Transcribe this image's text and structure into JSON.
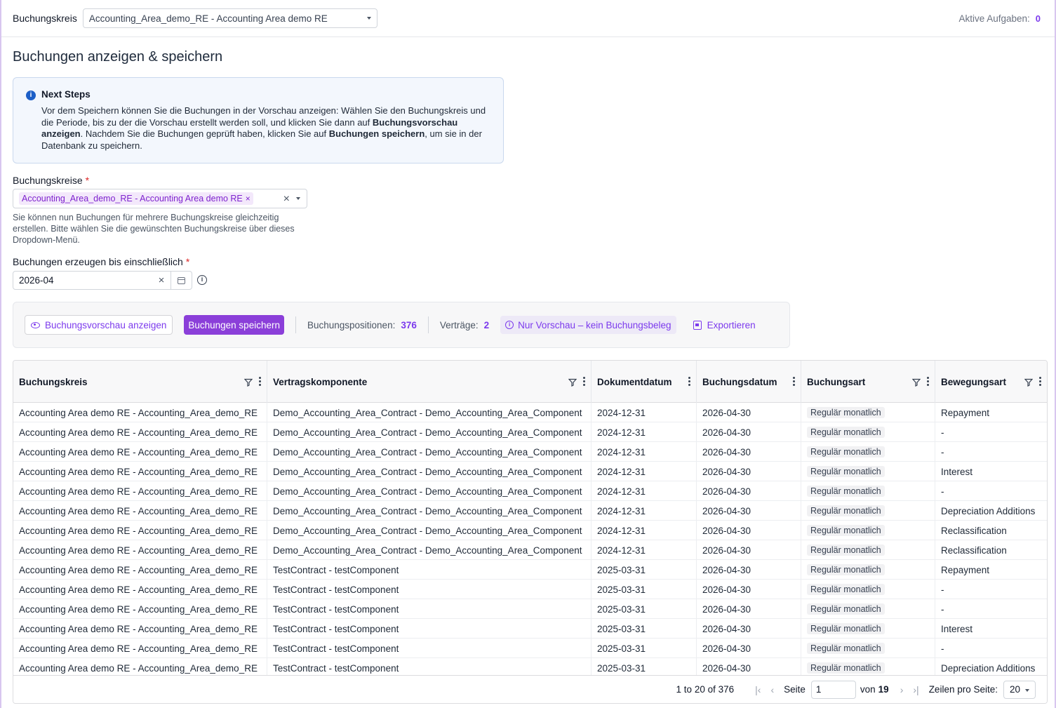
{
  "topbar": {
    "label": "Buchungskreis",
    "selected": "Accounting_Area_demo_RE - Accounting Area demo RE",
    "tasks_label": "Aktive Aufgaben:",
    "tasks_count": "0"
  },
  "page_title": "Buchungen anzeigen & speichern",
  "info": {
    "title": "Next Steps",
    "text_1": "Vor dem Speichern können Sie die Buchungen in der Vorschau anzeigen: Wählen Sie den Buchungskreis und die Periode, bis zu der die Vorschau erstellt werden soll, und klicken Sie dann auf ",
    "bold_1": "Buchungsvorschau anzeigen",
    "text_2": ". Nachdem Sie die Buchungen geprüft haben, klicken Sie auf ",
    "bold_2": "Buchungen speichern",
    "text_3": ", um sie in der Datenbank zu speichern."
  },
  "form": {
    "areas_label": "Buchungskreise",
    "required": "*",
    "area_chip": "Accounting_Area_demo_RE - Accounting Area demo RE",
    "helper": "Sie können nun Buchungen für mehrere Buchungskreise gleichzeitig erstellen. Bitte wählen Sie die gewünschten Buchungskreise über dieses Dropdown-Menü.",
    "until_label": "Buchungen erzeugen bis einschließlich",
    "until_value": "2026-04"
  },
  "toolbar": {
    "preview_label": "Buchungsvorschau anzeigen",
    "save_label": "Buchungen speichern",
    "positions_label": "Buchungspositionen:",
    "positions_count": "376",
    "contracts_label": "Verträge:",
    "contracts_count": "2",
    "preview_pill": "Nur Vorschau – kein Buchungsbeleg",
    "export_label": "Exportieren"
  },
  "grid": {
    "columns": [
      "Buchungskreis",
      "Vertragskomponente",
      "Dokumentdatum",
      "Buchungsdatum",
      "Buchungsart",
      "Bewegungsart"
    ],
    "rows": [
      [
        "Accounting Area demo RE - Accounting_Area_demo_RE",
        "Demo_Accounting_Area_Contract - Demo_Accounting_Area_Component",
        "2024-12-31",
        "2026-04-30",
        "Regulär monatlich",
        "Repayment"
      ],
      [
        "Accounting Area demo RE - Accounting_Area_demo_RE",
        "Demo_Accounting_Area_Contract - Demo_Accounting_Area_Component",
        "2024-12-31",
        "2026-04-30",
        "Regulär monatlich",
        "-"
      ],
      [
        "Accounting Area demo RE - Accounting_Area_demo_RE",
        "Demo_Accounting_Area_Contract - Demo_Accounting_Area_Component",
        "2024-12-31",
        "2026-04-30",
        "Regulär monatlich",
        "-"
      ],
      [
        "Accounting Area demo RE - Accounting_Area_demo_RE",
        "Demo_Accounting_Area_Contract - Demo_Accounting_Area_Component",
        "2024-12-31",
        "2026-04-30",
        "Regulär monatlich",
        "Interest"
      ],
      [
        "Accounting Area demo RE - Accounting_Area_demo_RE",
        "Demo_Accounting_Area_Contract - Demo_Accounting_Area_Component",
        "2024-12-31",
        "2026-04-30",
        "Regulär monatlich",
        "-"
      ],
      [
        "Accounting Area demo RE - Accounting_Area_demo_RE",
        "Demo_Accounting_Area_Contract - Demo_Accounting_Area_Component",
        "2024-12-31",
        "2026-04-30",
        "Regulär monatlich",
        "Depreciation Additions"
      ],
      [
        "Accounting Area demo RE - Accounting_Area_demo_RE",
        "Demo_Accounting_Area_Contract - Demo_Accounting_Area_Component",
        "2024-12-31",
        "2026-04-30",
        "Regulär monatlich",
        "Reclassification"
      ],
      [
        "Accounting Area demo RE - Accounting_Area_demo_RE",
        "Demo_Accounting_Area_Contract - Demo_Accounting_Area_Component",
        "2024-12-31",
        "2026-04-30",
        "Regulär monatlich",
        "Reclassification"
      ],
      [
        "Accounting Area demo RE - Accounting_Area_demo_RE",
        "TestContract - testComponent",
        "2025-03-31",
        "2026-04-30",
        "Regulär monatlich",
        "Repayment"
      ],
      [
        "Accounting Area demo RE - Accounting_Area_demo_RE",
        "TestContract - testComponent",
        "2025-03-31",
        "2026-04-30",
        "Regulär monatlich",
        "-"
      ],
      [
        "Accounting Area demo RE - Accounting_Area_demo_RE",
        "TestContract - testComponent",
        "2025-03-31",
        "2026-04-30",
        "Regulär monatlich",
        "-"
      ],
      [
        "Accounting Area demo RE - Accounting_Area_demo_RE",
        "TestContract - testComponent",
        "2025-03-31",
        "2026-04-30",
        "Regulär monatlich",
        "Interest"
      ],
      [
        "Accounting Area demo RE - Accounting_Area_demo_RE",
        "TestContract - testComponent",
        "2025-03-31",
        "2026-04-30",
        "Regulär monatlich",
        "-"
      ],
      [
        "Accounting Area demo RE - Accounting_Area_demo_RE",
        "TestContract - testComponent",
        "2025-03-31",
        "2026-04-30",
        "Regulär monatlich",
        "Depreciation Additions"
      ]
    ]
  },
  "pager": {
    "range": "1 to 20 of 376",
    "page_label": "Seite",
    "page_value": "1",
    "of_label": "von",
    "total_pages": "19",
    "rows_label": "Zeilen pro Seite:",
    "rows_value": "20"
  }
}
